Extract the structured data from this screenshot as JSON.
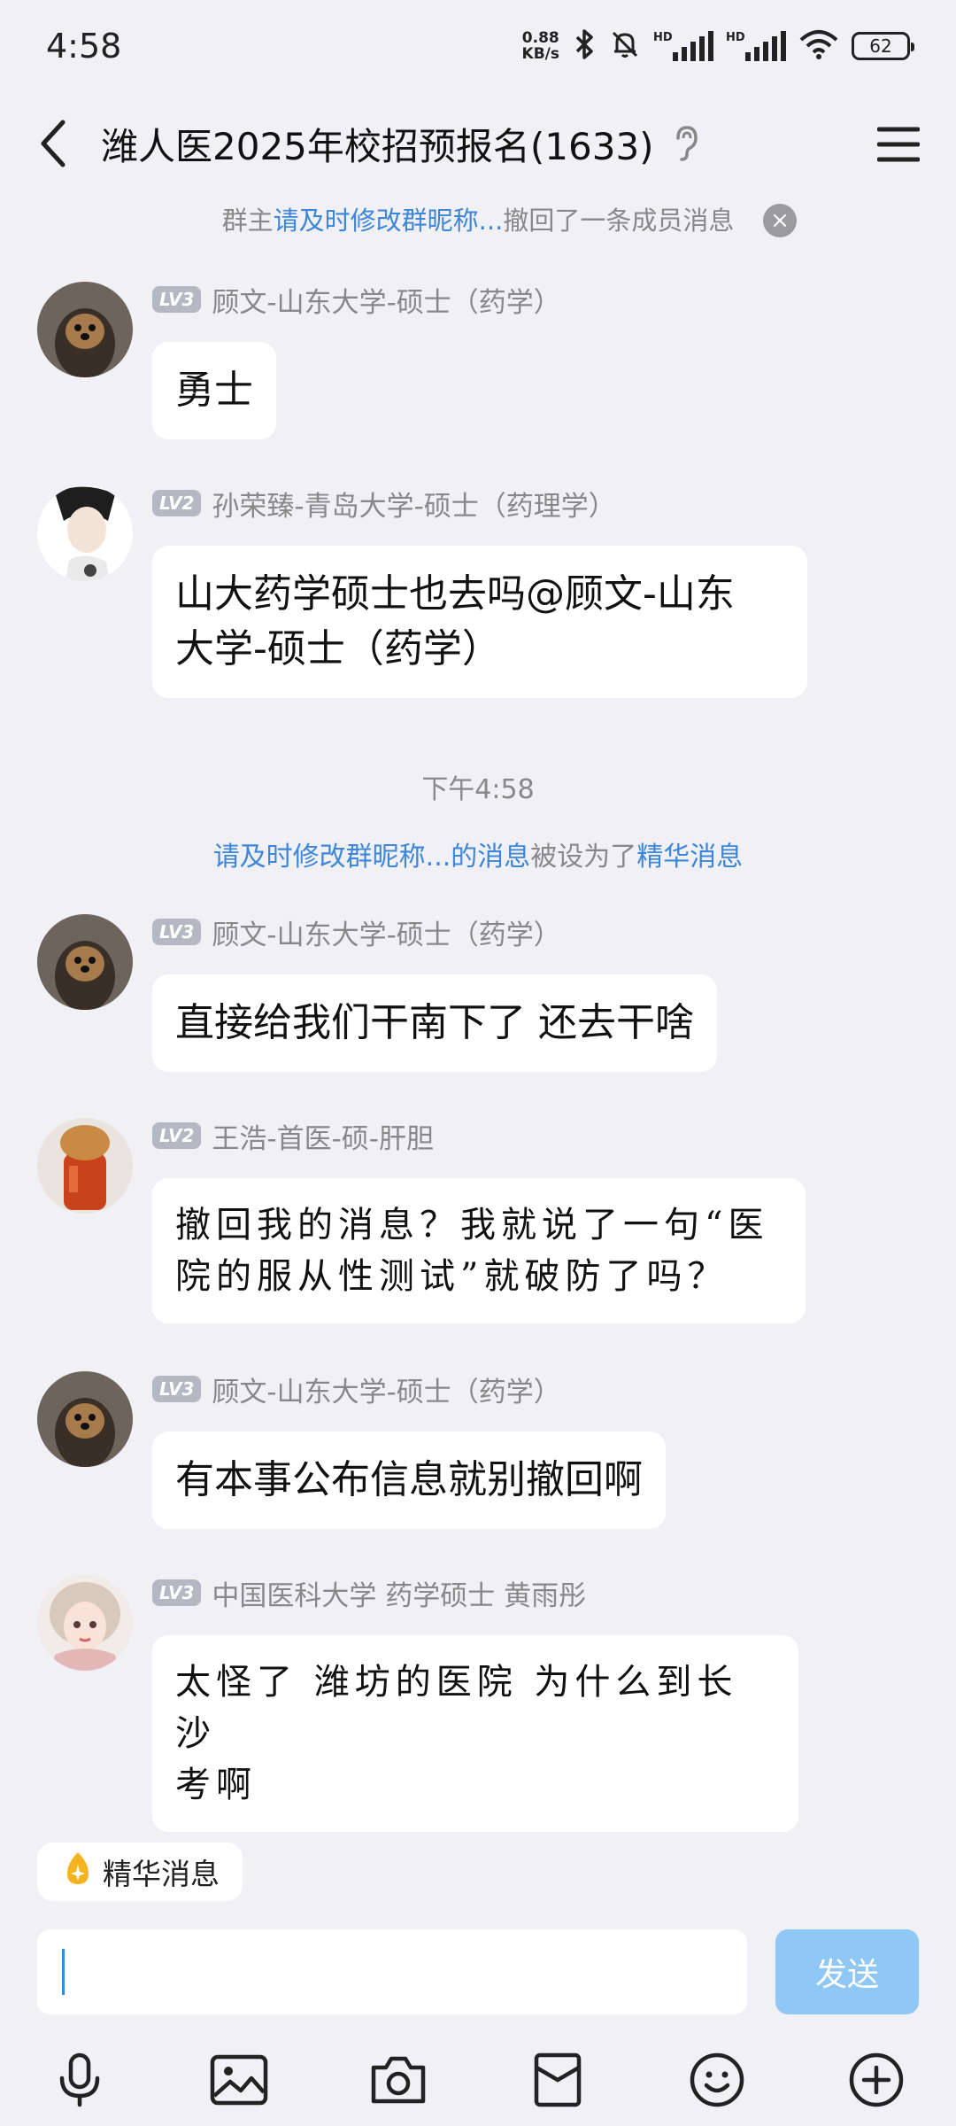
{
  "status_bar": {
    "time": "4:58",
    "net_speed_value": "0.88",
    "net_speed_unit": "KB/s",
    "hd_label": "HD",
    "battery": "62"
  },
  "header": {
    "title": "潍人医2025年校招预报名(1633)",
    "back_icon": "chevron-left-icon",
    "ear_icon": "ear-icon",
    "menu_icon": "hamburger-menu-icon"
  },
  "chat": {
    "recall_notice": {
      "prefix": "群主",
      "link": "请及时修改群昵称...",
      "suffix": "撤回了一条成员消息"
    },
    "time_divider": "下午4:58",
    "essence_notice": {
      "link1": "请及时修改群昵称...",
      "link2": "的消息",
      "middle": "被设为了",
      "link3": "精华消息"
    },
    "messages": [
      {
        "level": "LV3",
        "sender": "顾文-山东大学-硕士（药学）",
        "text": "勇士"
      },
      {
        "level": "LV2",
        "sender": "孙荣臻-青岛大学-硕士（药理学）",
        "line1": "山大药学硕士也去吗@顾文-山东",
        "line2": "大学-硕士（药学）"
      },
      {
        "level": "LV3",
        "sender": "顾文-山东大学-硕士（药学）",
        "text": "直接给我们干南下了 还去干啥"
      },
      {
        "level": "LV2",
        "sender": "王浩-首医-硕-肝胆",
        "line1": "撤回我的消息？我就说了一句“医",
        "line2": "院的服从性测试”就破防了吗？"
      },
      {
        "level": "LV3",
        "sender": "顾文-山东大学-硕士（药学）",
        "text": "有本事公布信息就别撤回啊"
      },
      {
        "level": "LV3",
        "sender": "中国医科大学 药学硕士 黄雨彤",
        "line1": "太怪了 潍坊的医院 为什么到长沙",
        "line2": "考啊"
      }
    ]
  },
  "bottom": {
    "highlight_label": "精华消息",
    "input_value": "",
    "send_label": "发送",
    "tools": [
      "microphone-icon",
      "image-icon",
      "camera-icon",
      "red-packet-icon",
      "emoji-icon",
      "plus-icon"
    ]
  },
  "colors": {
    "link": "#3d86d9",
    "send_button": "#8fc8f5",
    "background": "#f0f0f5",
    "level_badge": "#b5b7c2"
  }
}
